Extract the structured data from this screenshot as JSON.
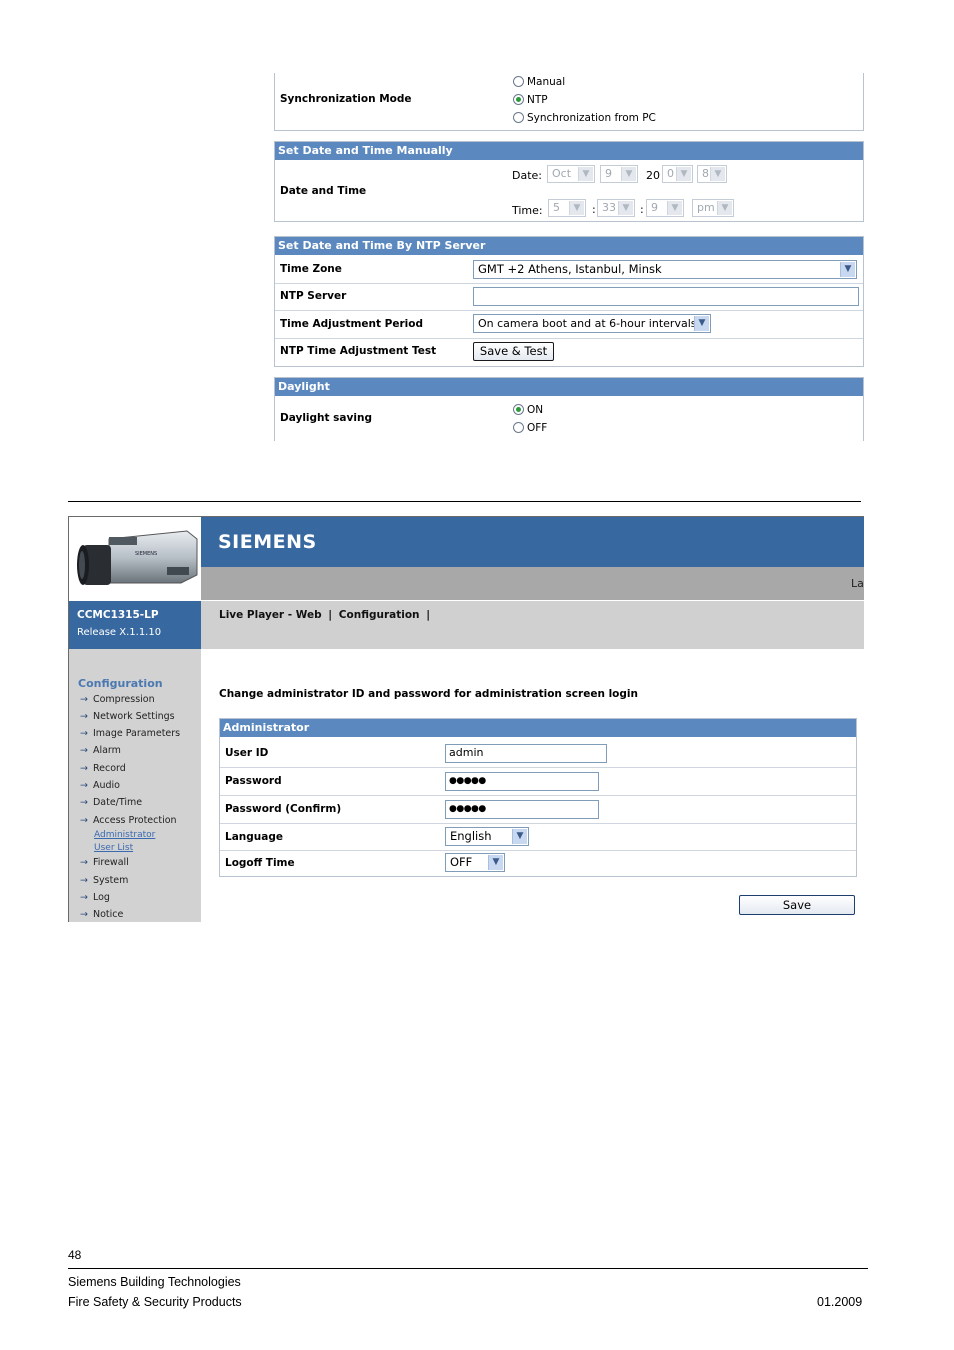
{
  "sync": {
    "label": "Synchronization Mode",
    "options": [
      "Manual",
      "NTP",
      "Synchronization from PC"
    ],
    "selected": "NTP"
  },
  "manual": {
    "header": "Set Date and Time Manually",
    "label": "Date and Time",
    "date_label": "Date:",
    "time_label": "Time:",
    "month": "Oct",
    "day": "9",
    "year_prefix": "20",
    "year_tens": "0",
    "year_ones": "8",
    "hour": "5",
    "minute": "33",
    "second": "9",
    "ampm": "pm",
    "colon": ":"
  },
  "ntp": {
    "header": "Set Date and Time By NTP Server",
    "timezone_label": "Time Zone",
    "timezone_value": "GMT +2 Athens, Istanbul, Minsk",
    "server_label": "NTP Server",
    "server_value": "",
    "period_label": "Time Adjustment Period",
    "period_value": "On camera boot and at 6-hour intervals",
    "test_label": "NTP Time Adjustment Test",
    "test_button": "Save & Test"
  },
  "daylight": {
    "header": "Daylight",
    "label": "Daylight saving",
    "options": [
      "ON",
      "OFF"
    ],
    "selected": "ON"
  },
  "app": {
    "brand": "SIEMENS",
    "model": "CCMC1315-LP",
    "release": "Release X.1.1.10",
    "lang_stub": "La",
    "camera_logo": "SIEMENS",
    "nav_links": [
      "Live Player - Web",
      "|",
      "Configuration",
      "|"
    ]
  },
  "sidebar": {
    "title": "Configuration",
    "items": [
      "Compression",
      "Network Settings",
      "Image Parameters",
      "Alarm",
      "Record",
      "Audio",
      "Date/Time",
      "Access Protection",
      "Firewall",
      "System",
      "Log",
      "Notice"
    ],
    "subitems": [
      "Administrator",
      "User List"
    ]
  },
  "admin": {
    "intro": "Change administrator ID and password for administration screen login",
    "header": "Administrator",
    "user_id_label": "User ID",
    "user_id_value": "admin",
    "password_label": "Password",
    "password_value": "●●●●●",
    "password_confirm_label": "Password (Confirm)",
    "password_confirm_value": "●●●●●",
    "language_label": "Language",
    "language_value": "English",
    "logoff_label": "Logoff Time",
    "logoff_value": "OFF",
    "save_button": "Save"
  },
  "footer": {
    "page_number": "48",
    "company": "Siemens Building Technologies",
    "division": "Fire Safety & Security Products",
    "date": "01.2009"
  },
  "colors": {
    "header_blue": "#5b88be",
    "brand_blue": "#3868a0",
    "radio_green": "#2a9a3a"
  }
}
